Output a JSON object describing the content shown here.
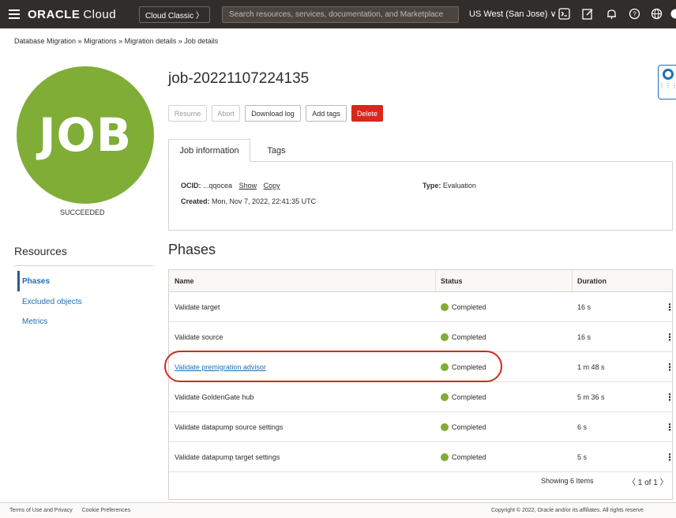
{
  "topbar": {
    "logo": "ORACLE",
    "logo_suffix": "Cloud",
    "cloud_classic": "Cloud Classic 〉",
    "search_placeholder": "Search resources, services, documentation, and Marketplace",
    "region": "US West (San Jose) ∨",
    "icons": [
      "hamburger-icon",
      "cloud-shell-icon",
      "edit-icon",
      "bell-icon",
      "help-icon",
      "globe-icon"
    ]
  },
  "breadcrumb": {
    "items": [
      "Database Migration",
      "Migrations",
      "Migration details",
      "Job details"
    ],
    "separator": "»"
  },
  "job": {
    "badge_text": "JOB",
    "status": "SUCCEEDED",
    "title": "job-20221107224135",
    "buttons": {
      "resume": "Resume",
      "abort": "Abort",
      "download_log": "Download log",
      "add_tags": "Add tags",
      "delete": "Delete"
    }
  },
  "tabs": [
    "Job information",
    "Tags"
  ],
  "info": {
    "ocid_label": "OCID:",
    "ocid_value": "...qqocea",
    "show": "Show",
    "copy": "Copy",
    "created_label": "Created:",
    "created_value": "Mon, Nov 7, 2022, 22:41:35 UTC",
    "type_label": "Type:",
    "type_value": "Evaluation"
  },
  "resources": {
    "title": "Resources",
    "items": [
      "Phases",
      "Excluded objects",
      "Metrics"
    ]
  },
  "phases": {
    "title": "Phases",
    "columns": [
      "Name",
      "Status",
      "Duration"
    ],
    "rows": [
      {
        "name": "Validate target",
        "status": "Completed",
        "duration": "16 s"
      },
      {
        "name": "Validate source",
        "status": "Completed",
        "duration": "16 s"
      },
      {
        "name": "Validate premigration advisor",
        "status": "Completed",
        "duration": "1 m 48 s"
      },
      {
        "name": "Validate GoldenGate hub",
        "status": "Completed",
        "duration": "5 m 36 s"
      },
      {
        "name": "Validate datapump source settings",
        "status": "Completed",
        "duration": "6 s"
      },
      {
        "name": "Validate datapump target settings",
        "status": "Completed",
        "duration": "5 s"
      }
    ],
    "kebab": "⋮",
    "showing": "Showing 6 Items",
    "pager": "〈 1 of 1 〉"
  },
  "footer": {
    "terms": "Terms of Use and Privacy",
    "cookies": "Cookie Preferences",
    "copyright": "Copyright © 2022, Oracle and/or its affiliates. All rights reserve"
  },
  "colors": {
    "topbar": "#312d2a",
    "badge": "#7fad36",
    "delete": "#d9271d",
    "link": "#1f6fb5",
    "highlight": "#d02a20"
  }
}
